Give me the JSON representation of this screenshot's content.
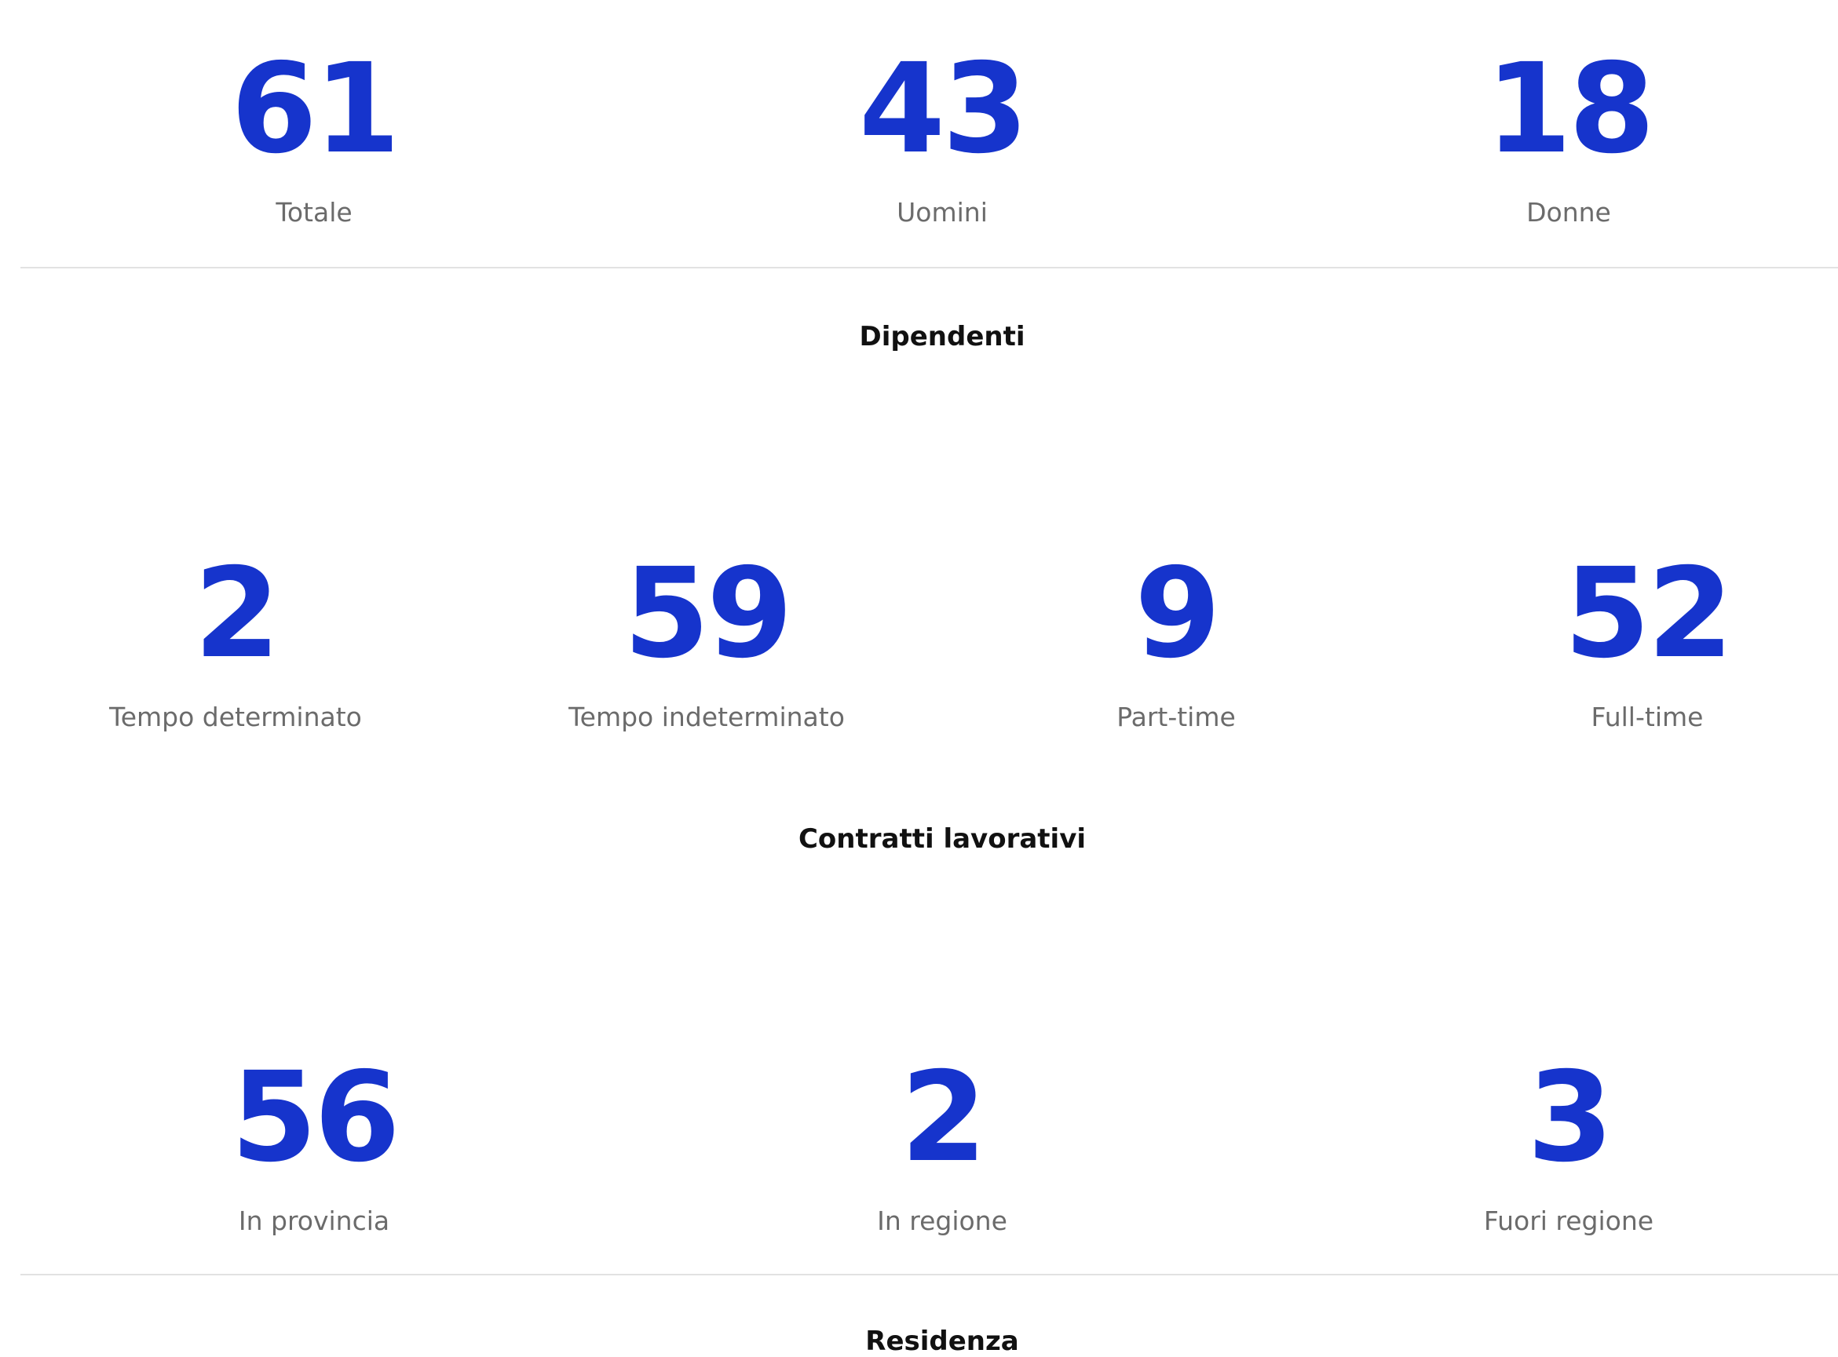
{
  "colors": {
    "accent": "#1634cc",
    "label": "#6b6b6b",
    "title": "#111111",
    "divider": "#e2e2e2"
  },
  "sections": {
    "dipendenti": {
      "title": "Dipendenti",
      "stats": [
        {
          "value": "61",
          "label": "Totale"
        },
        {
          "value": "43",
          "label": "Uomini"
        },
        {
          "value": "18",
          "label": "Donne"
        }
      ]
    },
    "contratti": {
      "title": "Contratti lavorativi",
      "stats": [
        {
          "value": "2",
          "label": "Tempo determinato"
        },
        {
          "value": "59",
          "label": "Tempo indeterminato"
        },
        {
          "value": "9",
          "label": "Part-time"
        },
        {
          "value": "52",
          "label": "Full-time"
        }
      ]
    },
    "residenza": {
      "title": "Residenza",
      "stats": [
        {
          "value": "56",
          "label": "In provincia"
        },
        {
          "value": "2",
          "label": "In regione"
        },
        {
          "value": "3",
          "label": "Fuori regione"
        }
      ]
    }
  }
}
